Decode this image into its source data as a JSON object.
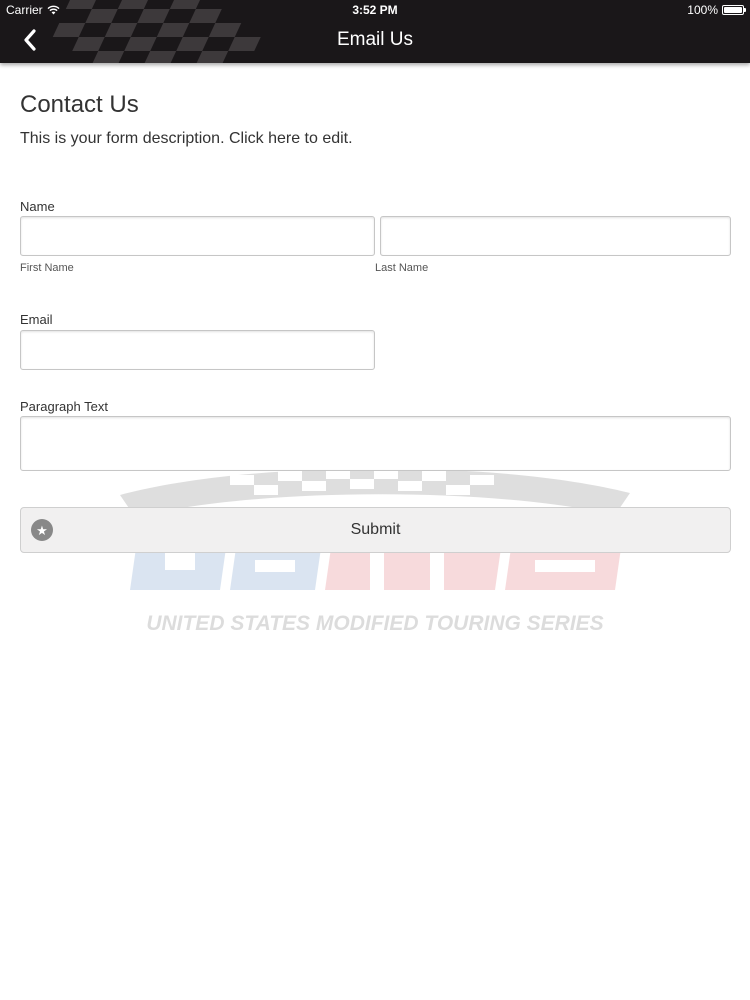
{
  "status_bar": {
    "carrier": "Carrier",
    "time": "3:52 PM",
    "battery": "100%",
    "battery_level": 1.0
  },
  "nav": {
    "title": "Email Us",
    "back_icon": "chevron-left-icon"
  },
  "form": {
    "title": "Contact Us",
    "description": "This is your form description. Click here to edit.",
    "name": {
      "label": "Name",
      "first": {
        "sub_label": "First Name",
        "value": "",
        "placeholder": ""
      },
      "last": {
        "sub_label": "Last Name",
        "value": "",
        "placeholder": ""
      }
    },
    "email": {
      "label": "Email",
      "value": "",
      "placeholder": ""
    },
    "paragraph": {
      "label": "Paragraph Text",
      "value": "",
      "placeholder": ""
    },
    "submit": {
      "label": "Submit",
      "icon": "star-icon"
    }
  },
  "watermark": {
    "tagline": "UNITED STATES MODIFIED TOURING SERIES"
  },
  "colors": {
    "nav_background": "#1a1719",
    "text": "#333333",
    "input_border": "#c6c6c6",
    "button_background": "#f1f0f0",
    "watermark_blue": "#1f5fae",
    "watermark_red": "#d2232a"
  }
}
